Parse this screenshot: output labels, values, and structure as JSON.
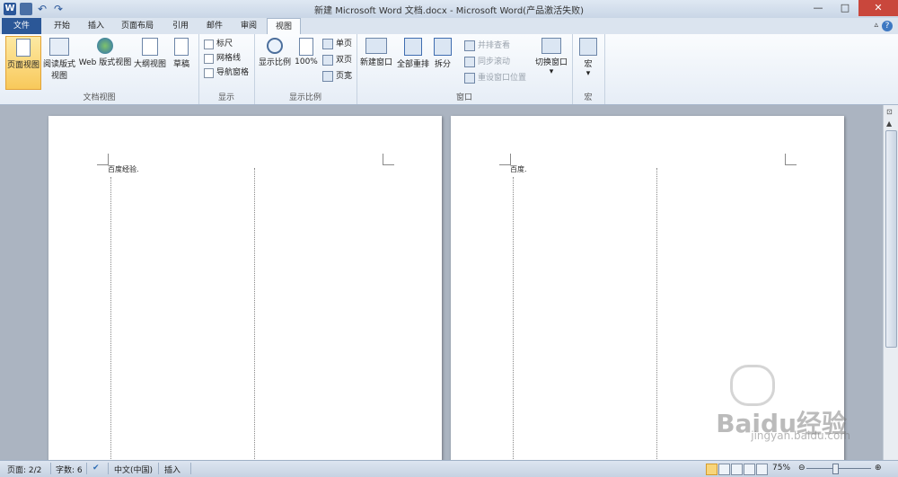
{
  "app": {
    "title": "新建 Microsoft Word 文档.docx - Microsoft Word(产品激活失败)",
    "window_buttons": {
      "minimize": "—",
      "maximize": "□",
      "close": "✕"
    }
  },
  "quick_access": {
    "icons": [
      "word-icon",
      "save-icon",
      "undo-icon",
      "redo-icon"
    ]
  },
  "tabs": [
    "文件",
    "开始",
    "插入",
    "页面布局",
    "引用",
    "邮件",
    "审阅",
    "视图"
  ],
  "active_tab": "视图",
  "ribbon": {
    "doc_views": {
      "label": "文档视图",
      "buttons": [
        "页面视图",
        "阅读版式视图",
        "Web 版式视图",
        "大纲视图",
        "草稿"
      ]
    },
    "show": {
      "label": "显示",
      "checkboxes": [
        "标尺",
        "网格线",
        "导航窗格"
      ]
    },
    "zoom": {
      "label": "显示比例",
      "zoom_btn": "显示比例",
      "hundred": "100%",
      "single": "单页",
      "double": "双页",
      "width": "页宽"
    },
    "window": {
      "label": "窗口",
      "new_window": "新建窗口",
      "arrange_all": "全部重排",
      "split": "拆分",
      "side_by_side": "并排查看",
      "sync_scroll": "同步滚动",
      "reset_pos": "重设窗口位置",
      "switch": "切换窗口"
    },
    "macro": {
      "label": "宏",
      "button": "宏"
    }
  },
  "document": {
    "page1_text": "百度经验.",
    "page2_text": "百度."
  },
  "watermark": {
    "brand": "Baidu经验",
    "url": "jingyan.baidu.com"
  },
  "status": {
    "page": "页面: 2/2",
    "words": "字数: 6",
    "language": "中文(中国)",
    "mode": "插入",
    "zoom": "75%"
  },
  "colors": {
    "file_tab": "#2b5797",
    "selected_button": "#f8c95b",
    "close_button": "#c9473c"
  }
}
